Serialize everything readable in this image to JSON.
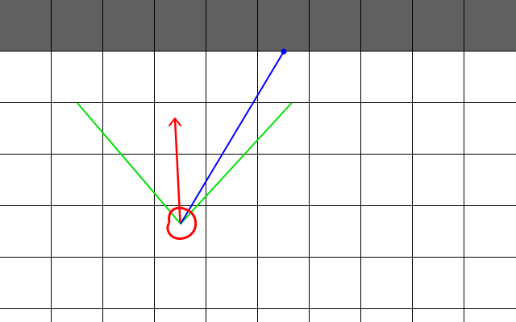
{
  "grid": {
    "cols": 10,
    "rows": 7,
    "blocked_row": 0,
    "colors": {
      "background": "#ffffff",
      "blocked": "#606060",
      "lines": "#000000"
    }
  },
  "agent": {
    "cell": {
      "col": 3,
      "row": 4
    },
    "marker_color": "#ff0000",
    "heading": "up"
  },
  "view_cone": {
    "color": "#00e000",
    "left_edge_end": {
      "col": 1.5,
      "row": 2
    },
    "right_edge_end": {
      "col": 5.65,
      "row": 2
    }
  },
  "target_ray": {
    "color": "#0000ff",
    "end": {
      "col": 5.5,
      "row": 1
    }
  }
}
